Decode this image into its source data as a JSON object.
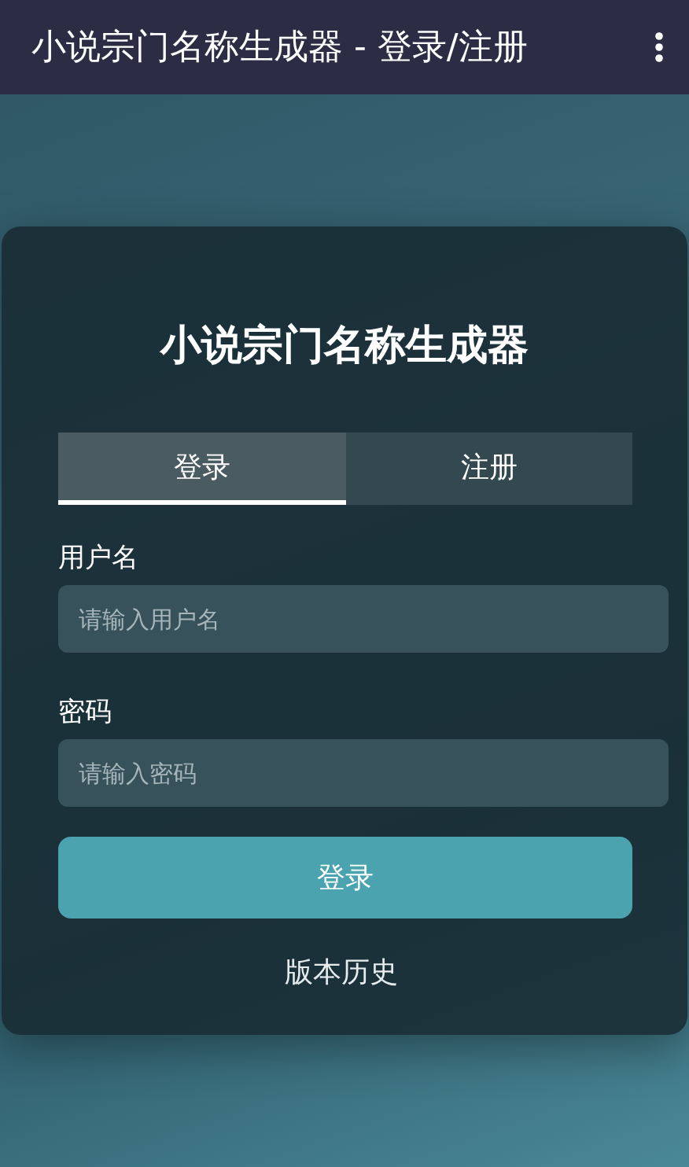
{
  "app_bar": {
    "title": "小说宗门名称生成器 - 登录/注册"
  },
  "card": {
    "title": "小说宗门名称生成器",
    "tabs": [
      {
        "label": "登录",
        "selected": true
      },
      {
        "label": "注册",
        "selected": false
      }
    ],
    "fields": [
      {
        "label": "用户名",
        "placeholder": "请输入用户名"
      },
      {
        "label": "密码",
        "placeholder": "请输入密码"
      }
    ],
    "submit": "登录",
    "link": "版本历史"
  }
}
